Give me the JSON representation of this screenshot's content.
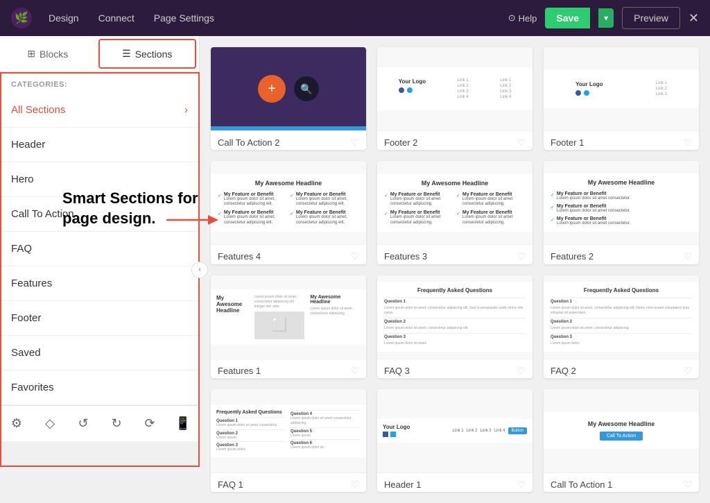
{
  "topNav": {
    "design": "Design",
    "connect": "Connect",
    "pageSettings": "Page Settings",
    "help": "Help",
    "save": "Save",
    "preview": "Preview"
  },
  "sidebar": {
    "blocksTab": "Blocks",
    "sectionsTab": "Sections",
    "categoriesLabel": "CATEGORIES:",
    "categories": [
      {
        "id": "all",
        "label": "All Sections",
        "active": true
      },
      {
        "id": "header",
        "label": "Header",
        "active": false
      },
      {
        "id": "hero",
        "label": "Hero",
        "active": false
      },
      {
        "id": "cta",
        "label": "Call To Action",
        "active": false
      },
      {
        "id": "faq",
        "label": "FAQ",
        "active": false
      },
      {
        "id": "features",
        "label": "Features",
        "active": false
      },
      {
        "id": "footer",
        "label": "Footer",
        "active": false
      },
      {
        "id": "saved",
        "label": "Saved",
        "active": false
      },
      {
        "id": "favorites",
        "label": "Favorites",
        "active": false
      }
    ],
    "callout": "Smart Sections for\npage design."
  },
  "templates": [
    {
      "id": "cta2",
      "label": "Call To Action 2",
      "type": "cta"
    },
    {
      "id": "footer2",
      "label": "Footer 2",
      "type": "footer2"
    },
    {
      "id": "footer1",
      "label": "Footer 1",
      "type": "footer1"
    },
    {
      "id": "features4",
      "label": "Features 4",
      "type": "features4"
    },
    {
      "id": "features3",
      "label": "Features 3",
      "type": "features3"
    },
    {
      "id": "features2",
      "label": "Features 2",
      "type": "features2"
    },
    {
      "id": "features1",
      "label": "Features 1",
      "type": "features1"
    },
    {
      "id": "faq3",
      "label": "FAQ 3",
      "type": "faq3"
    },
    {
      "id": "faq2",
      "label": "FAQ 2",
      "type": "faq2"
    },
    {
      "id": "faq1",
      "label": "FAQ 1",
      "type": "faq1"
    },
    {
      "id": "header1",
      "label": "Header 1",
      "type": "header1"
    },
    {
      "id": "cta1",
      "label": "Call To Action 1",
      "type": "cta1"
    }
  ]
}
